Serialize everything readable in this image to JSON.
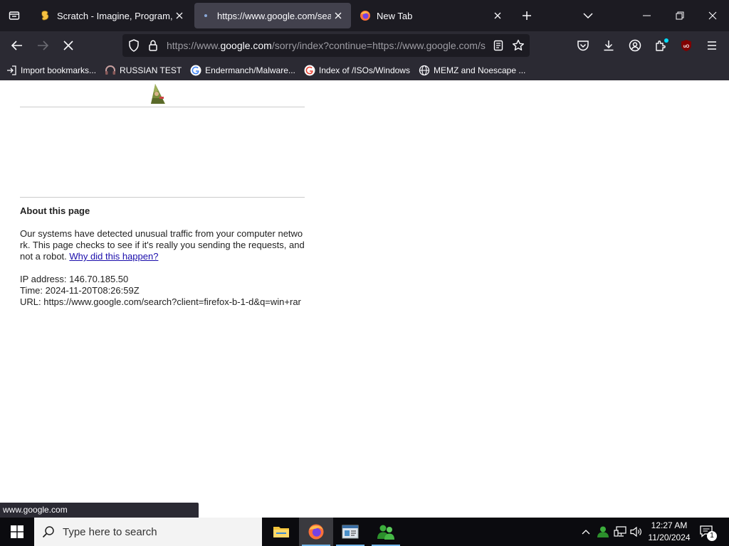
{
  "tabs": [
    {
      "title": "Scratch - Imagine, Program, Share",
      "favicon": "scratch-icon",
      "active": false
    },
    {
      "title": "https://www.google.com/search",
      "favicon": "loading-dot-icon",
      "active": true
    },
    {
      "title": "New Tab",
      "favicon": "firefox-icon",
      "active": false
    }
  ],
  "url": {
    "prefix": "https://www.",
    "host": "google.com",
    "rest": "/sorry/index?continue=https://www.google.com/s"
  },
  "bookmarks": [
    {
      "label": "Import bookmarks...",
      "icon": "import-icon"
    },
    {
      "label": "RUSSIAN TEST",
      "icon": "headphones-icon"
    },
    {
      "label": "Endermanch/Malware...",
      "icon": "google-icon"
    },
    {
      "label": "Index of /ISOs/Windows",
      "icon": "google-icon"
    },
    {
      "label": "MEMZ and Noescape ...",
      "icon": "globe-icon"
    }
  ],
  "page": {
    "heading": "About this page",
    "message": "Our systems have detected unusual traffic from your computer network. This page checks to see if it's really you sending the requests, and not a robot.",
    "link": "Why did this happen?",
    "ip": "IP address: 146.70.185.50",
    "time": "Time: 2024-11-20T08:26:59Z",
    "url_line": "URL: https://www.google.com/search?client=firefox-b-1-d&q=win+rar"
  },
  "status_text": "www.google.com",
  "taskbar": {
    "search_placeholder": "Type here to search",
    "time": "12:27 AM",
    "date": "11/20/2024",
    "notification_count": "1"
  },
  "colors": {
    "chrome_dark": "#1c1b22",
    "toolbar": "#2b2a33",
    "link": "#1a0dab",
    "taskbar": "#0b0b0f"
  }
}
